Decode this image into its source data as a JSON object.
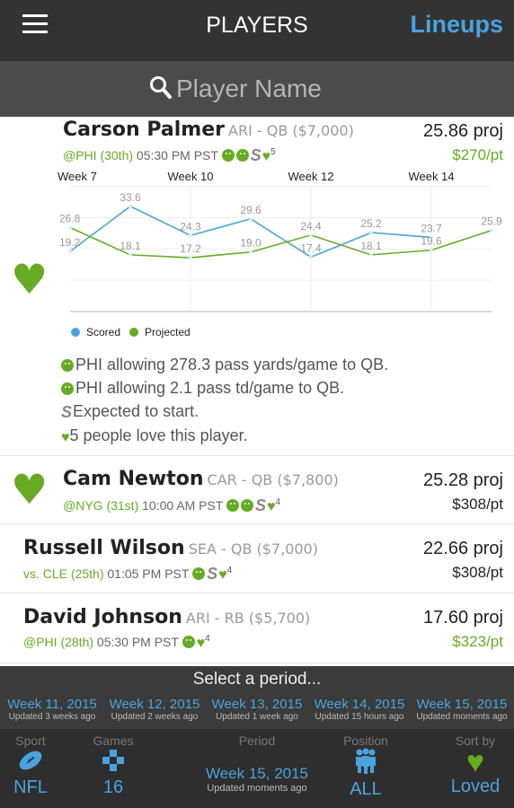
{
  "header": {
    "title": "PLAYERS",
    "lineups_label": "Lineups",
    "menu_icon": "hamburger-icon"
  },
  "search": {
    "placeholder": "Player Name"
  },
  "colors": {
    "green": "#66ab23",
    "blue": "#4aa3df",
    "header": "#333333"
  },
  "players": [
    {
      "name": "Carson Palmer",
      "meta": "ARI - QB  ($7,000)",
      "opponent": "@PHI (30th)",
      "time": "05:30 PM PST",
      "smileys": 2,
      "start": true,
      "loves": "5",
      "proj": "25.86 proj",
      "price": "$270/pt",
      "price_green": true,
      "loved": true,
      "notes": [
        "PHI allowing 278.3 pass yards/game to QB.",
        "PHI allowing 2.1 pass td/game to QB.",
        "Expected to start.",
        "5 people love this player."
      ]
    },
    {
      "name": "Cam Newton",
      "meta": "CAR - QB  ($7,800)",
      "opponent": "@NYG (31st)",
      "time": "10:00 AM PST",
      "smileys": 2,
      "start": true,
      "loves": "4",
      "proj": "25.28 proj",
      "price": "$308/pt",
      "price_green": false,
      "loved": true
    },
    {
      "name": "Russell Wilson",
      "meta": "SEA - QB  ($7,000)",
      "opponent": "vs. CLE (25th)",
      "time": "01:05 PM PST",
      "smileys": 1,
      "start": true,
      "loves": "4",
      "proj": "22.66 proj",
      "price": "$308/pt",
      "price_green": false,
      "loved": false
    },
    {
      "name": "David Johnson",
      "meta": "ARI - RB  ($5,700)",
      "opponent": "@PHI (28th)",
      "time": "05:30 PM PST",
      "smileys": 1,
      "start": false,
      "loves": "4",
      "proj": "17.60 proj",
      "price": "$323/pt",
      "price_green": true,
      "loved": false
    }
  ],
  "chart_data": {
    "type": "line",
    "x_tick_labels": [
      {
        "index": 0,
        "label": "Week 7"
      },
      {
        "index": 2,
        "label": "Week 10"
      },
      {
        "index": 4,
        "label": "Week 12"
      },
      {
        "index": 6,
        "label": "Week 14"
      }
    ],
    "ylim": [
      0,
      40
    ],
    "grid": true,
    "legend_placement": "bottom-left",
    "series": [
      {
        "name": "Scored",
        "color": "#4aa3df",
        "values": [
          19.2,
          33.6,
          24.3,
          29.6,
          17.4,
          25.2,
          23.7
        ]
      },
      {
        "name": "Projected",
        "color": "#66ab23",
        "values": [
          26.8,
          18.1,
          17.2,
          19.0,
          24.4,
          18.1,
          19.6,
          25.9
        ]
      }
    ]
  },
  "picker": {
    "title": "Select a period...",
    "weeks": [
      {
        "week": "Week 11, 2015",
        "updated": "Updated 3 weeks ago"
      },
      {
        "week": "Week 12, 2015",
        "updated": "Updated 2 weeks ago"
      },
      {
        "week": "Week 13, 2015",
        "updated": "Updated 1 week ago"
      },
      {
        "week": "Week 14, 2015",
        "updated": "Updated 15 hours ago"
      },
      {
        "week": "Week 15, 2015",
        "updated": "Updated moments ago"
      }
    ]
  },
  "nav": {
    "sport": {
      "label": "Sport",
      "value": "NFL",
      "icon": "football-icon"
    },
    "games": {
      "label": "Games",
      "value": "16",
      "icon": "gamepad-icon"
    },
    "period": {
      "label": "Period",
      "value": "Week 15, 2015",
      "updated": "Updated moments ago"
    },
    "position": {
      "label": "Position",
      "value": "ALL",
      "icon": "people-icon"
    },
    "sort": {
      "label": "Sort by",
      "value": "Loved",
      "icon": "heart-icon"
    }
  }
}
